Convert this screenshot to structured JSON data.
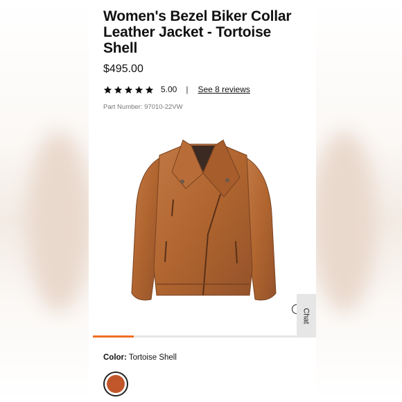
{
  "product": {
    "title": "Women's Bezel Biker Collar Leather Jacket - Tortoise Shell",
    "price": "$495.00",
    "rating_value": "5.00",
    "rating_stars": 5,
    "rating_separator": "|",
    "reviews_link": "See 8 reviews",
    "part_number": "Part Number: 97010-22VW",
    "image_icon": "leather-jacket-image"
  },
  "chat": {
    "label": "Chat"
  },
  "carousel": {
    "progress_fraction": 0.2
  },
  "color": {
    "label": "Color:",
    "value": "Tortoise Shell",
    "swatch_color": "#c0562a"
  },
  "colors": {
    "accent": "#f26f21",
    "jacket": "#b5693a",
    "jacket_dark": "#8a4a24"
  }
}
